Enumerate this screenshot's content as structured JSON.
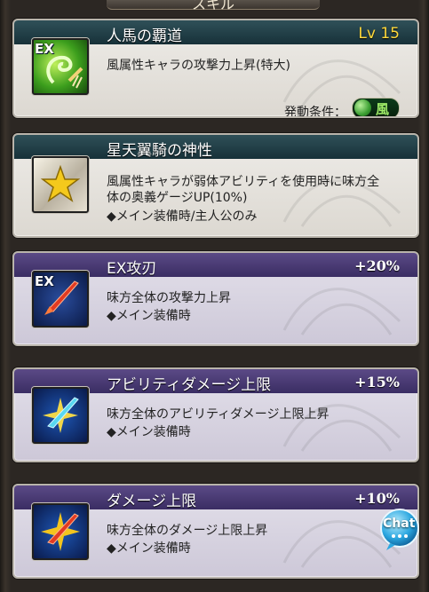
{
  "header": {
    "title": "スキル"
  },
  "skills": [
    {
      "name": "人馬の覇道",
      "level": "Lv 15",
      "description": "風属性キャラの攻撃力上昇(特大)",
      "condition_label": "発動条件：",
      "condition_element": "風",
      "icon": "wind-ex-sword-icon",
      "icon_badge": "EX"
    },
    {
      "name": "星天翼騎の神性",
      "description_line1": "風属性キャラが弱体アビリティを使用時に味方全",
      "description_line2": "体の奥義ゲージUP(10%)",
      "note": "◆メイン装備時/主人公のみ",
      "icon": "gold-star-icon"
    },
    {
      "name": "EX攻刃",
      "value": "+20%",
      "description": "味方全体の攻撃力上昇",
      "note": "◆メイン装備時",
      "icon": "ex-attack-sword-icon",
      "icon_badge": "EX"
    },
    {
      "name": "アビリティダメージ上限",
      "value": "+15%",
      "description": "味方全体のアビリティダメージ上限上昇",
      "note": "◆メイン装備時",
      "icon": "ability-damage-cap-icon"
    },
    {
      "name": "ダメージ上限",
      "value": "+10%",
      "description": "味方全体のダメージ上限上昇",
      "note": "◆メイン装備時",
      "icon": "damage-cap-icon"
    }
  ],
  "chat_button": {
    "label": "Chat"
  },
  "colors": {
    "level": "#ffd93b",
    "support_title_bar": "#173139",
    "weapon_title_bar": "#3a2d63",
    "wind_element": "#3b9f32"
  }
}
